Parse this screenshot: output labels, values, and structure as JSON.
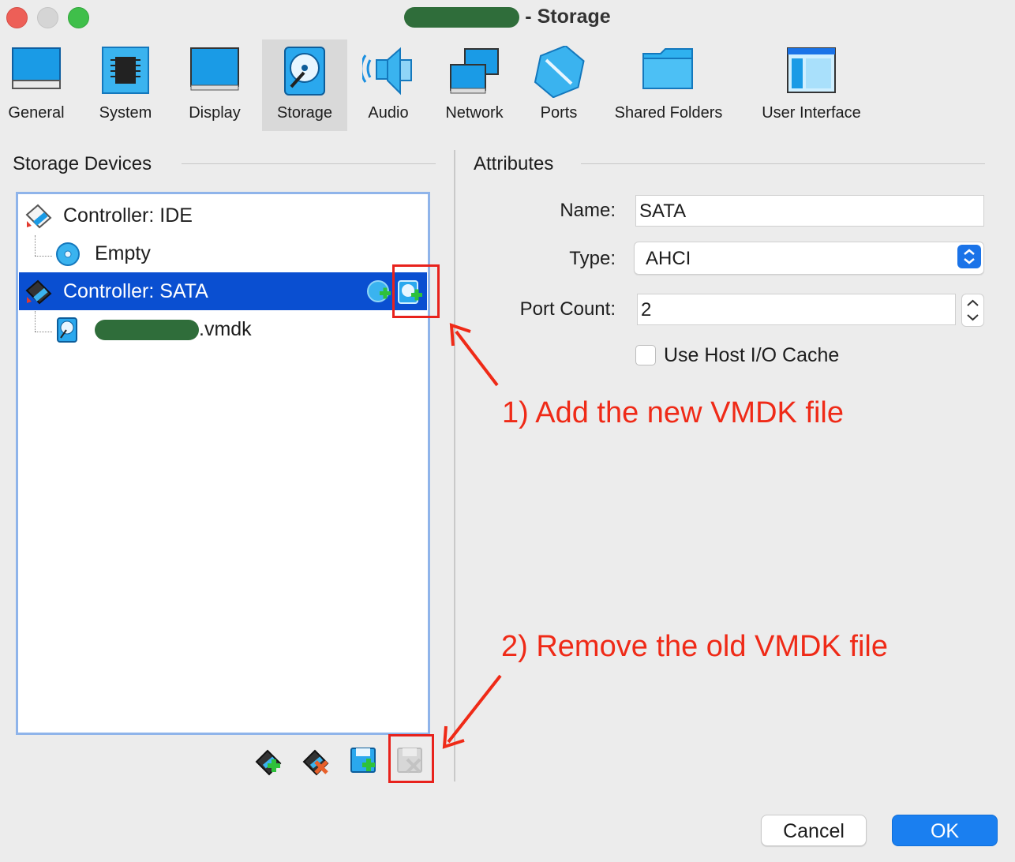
{
  "window": {
    "title_suffix": "- Storage"
  },
  "toolbar": {
    "items": [
      {
        "label": "General",
        "icon": "general-icon"
      },
      {
        "label": "System",
        "icon": "system-chip-icon"
      },
      {
        "label": "Display",
        "icon": "display-monitor-icon"
      },
      {
        "label": "Storage",
        "icon": "storage-disk-icon",
        "selected": true
      },
      {
        "label": "Audio",
        "icon": "audio-speaker-icon"
      },
      {
        "label": "Network",
        "icon": "network-icon"
      },
      {
        "label": "Ports",
        "icon": "ports-connector-icon"
      },
      {
        "label": "Shared Folders",
        "icon": "shared-folder-icon"
      },
      {
        "label": "User Interface",
        "icon": "user-interface-icon"
      }
    ]
  },
  "storage": {
    "header": "Storage Devices",
    "tree": {
      "controller_ide": "Controller: IDE",
      "ide_child": "Empty",
      "controller_sata": "Controller: SATA",
      "sata_child_suffix": ".vmdk"
    }
  },
  "attributes": {
    "header": "Attributes",
    "name_label": "Name:",
    "name_value": "SATA",
    "type_label": "Type:",
    "type_value": "AHCI",
    "port_count_label": "Port Count:",
    "port_count_value": "2",
    "host_io_cache_label": "Use Host I/O Cache",
    "host_io_cache_checked": false
  },
  "annotations": {
    "step1": "1) Add the new VMDK file",
    "step2": "2) Remove the old VMDK file",
    "color": "#ef2a17"
  },
  "buttons": {
    "cancel": "Cancel",
    "ok": "OK"
  },
  "colors": {
    "selection": "#0a4fd1",
    "accent": "#1a7ff0",
    "annotation": "#e8221c"
  }
}
